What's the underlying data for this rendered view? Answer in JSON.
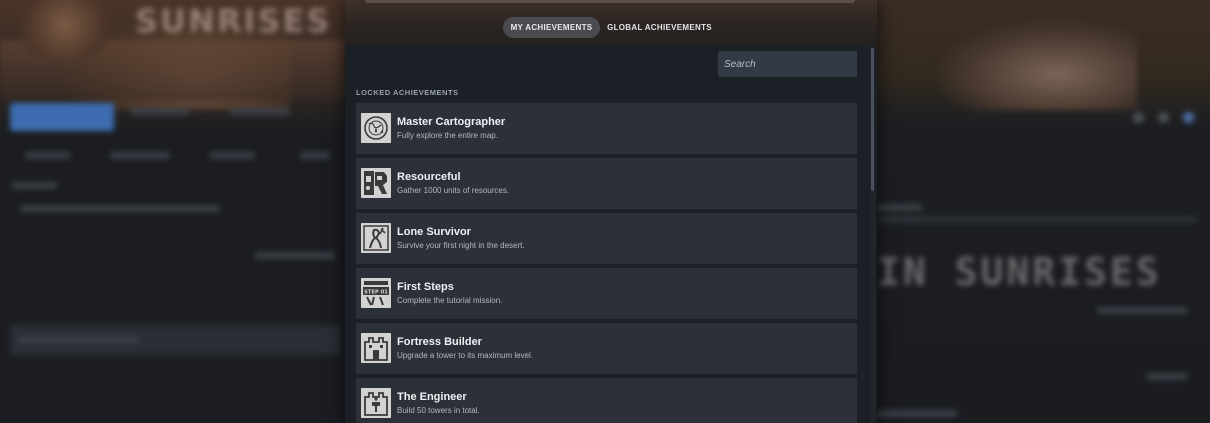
{
  "tabs": [
    {
      "label": "MY ACHIEVEMENTS",
      "active": true
    },
    {
      "label": "GLOBAL ACHIEVEMENTS",
      "active": false
    }
  ],
  "search": {
    "placeholder": "Search",
    "value": ""
  },
  "section_title": "LOCKED ACHIEVEMENTS",
  "achievements": [
    {
      "name": "Master Cartographer",
      "description": "Fully explore the entire map.",
      "icon": "map-icon"
    },
    {
      "name": "Resourceful",
      "description": "Gather 1000 units of resources.",
      "icon": "resource-icon"
    },
    {
      "name": "Lone Survivor",
      "description": "Survive your first night in the desert.",
      "icon": "survivor-icon"
    },
    {
      "name": "First Steps",
      "description": "Complete the tutorial mission.",
      "icon": "step-01-icon",
      "icon_text": "STEP 01"
    },
    {
      "name": "Fortress Builder",
      "description": "Upgrade a tower to its maximum level.",
      "icon": "fortress-icon"
    },
    {
      "name": "The Engineer",
      "description": "Build 50 towers in total.",
      "icon": "engineer-icon"
    }
  ],
  "background": {
    "game_logo_text": "SUNRISES",
    "game_logo_text_right": "IN SUNRISES"
  },
  "colors": {
    "modal_bg": "#1b1f26",
    "row_bg": "#2b3039",
    "active_tab_bg": "#4a4b4e",
    "accent_blue": "#3d6db0"
  }
}
